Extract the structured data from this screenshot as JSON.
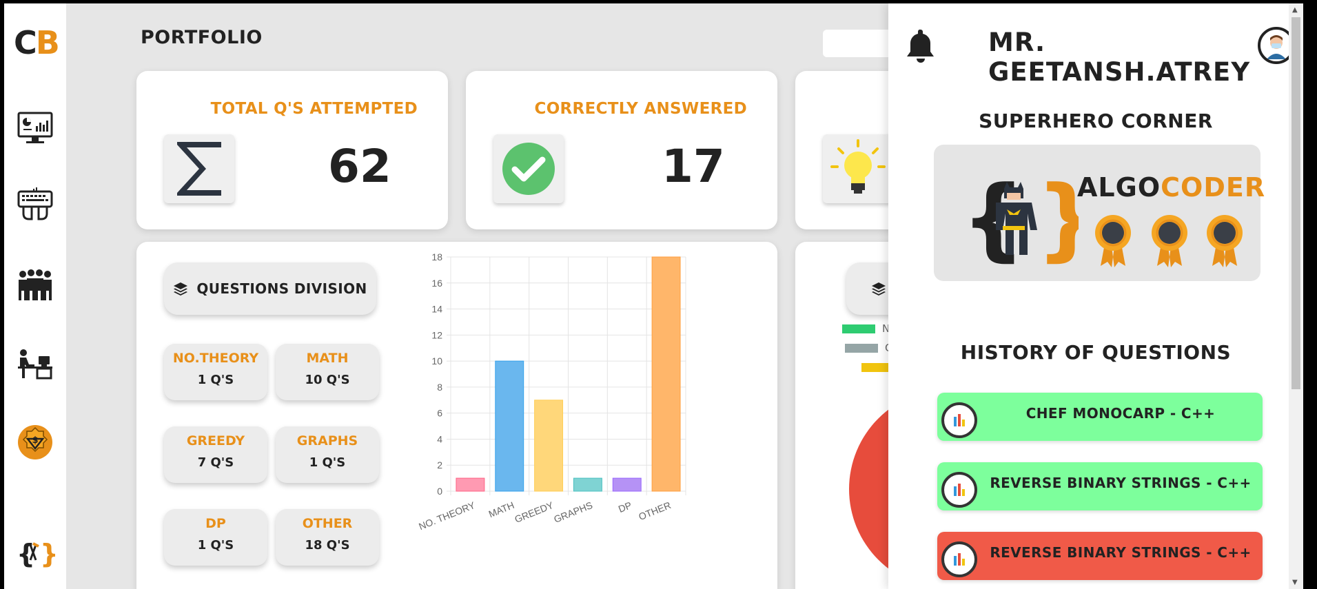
{
  "brand": {
    "logo_c": "C",
    "logo_b": "B"
  },
  "sidebar": {
    "items": [
      {
        "icon": "dashboard-icon"
      },
      {
        "icon": "keyboard-practice-icon"
      },
      {
        "icon": "community-icon"
      },
      {
        "icon": "workspace-icon"
      },
      {
        "icon": "premium-badge-icon"
      },
      {
        "icon": "code-tools-icon"
      }
    ]
  },
  "header": {
    "title": "PORTFOLIO"
  },
  "stats": {
    "attempted": {
      "label": "TOTAL Q'S ATTEMPTED",
      "value": "62",
      "icon": "sigma-icon"
    },
    "correct": {
      "label": "CORRECTLY ANSWERED",
      "value": "17",
      "icon": "check-circle-icon"
    },
    "third": {
      "icon": "lightbulb-icon"
    }
  },
  "division": {
    "button_label": "QUESTIONS DIVISION",
    "tiles": [
      {
        "title": "NO.THEORY",
        "count": "1 Q'S"
      },
      {
        "title": "MATH",
        "count": "10 Q'S"
      },
      {
        "title": "GREEDY",
        "count": "7 Q'S"
      },
      {
        "title": "GRAPHS",
        "count": "1 Q'S"
      },
      {
        "title": "DP",
        "count": "1 Q'S"
      },
      {
        "title": "OTHER",
        "count": "18 Q'S"
      }
    ]
  },
  "chart_data": {
    "type": "bar",
    "categories": [
      "NO. THEORY",
      "MATH",
      "GREEDY",
      "GRAPHS",
      "DP",
      "OTHER"
    ],
    "values": [
      1,
      10,
      7,
      1,
      1,
      18
    ],
    "colors": [
      "#ff9ab2",
      "#6ab7ee",
      "#ffd77a",
      "#7fd3d3",
      "#b592f5",
      "#ffb66a"
    ],
    "borders": [
      "#ff6384",
      "#36a2eb",
      "#ffce56",
      "#4bc0c0",
      "#9966ff",
      "#ff9f40"
    ],
    "ylim": [
      0,
      18
    ],
    "yticks": [
      "0",
      "2",
      "4",
      "6",
      "8",
      "10",
      "12",
      "14",
      "16",
      "18"
    ],
    "title": "",
    "xlabel": "",
    "ylabel": "",
    "grid": true
  },
  "legend_fragment": {
    "colors": [
      "#2ecc71",
      "#95a5a6",
      "#f1c40f"
    ],
    "labels": [
      "N",
      "C",
      ""
    ]
  },
  "user": {
    "name": "MR. GEETANSH.ATREY"
  },
  "superhero": {
    "section_title": "SUPERHERO CORNER",
    "name_part1": "ALGO",
    "name_part2": "CODER",
    "medal_count": 3
  },
  "history": {
    "section_title": "HISTORY OF QUESTIONS",
    "items": [
      {
        "label": "CHEF MONOCARP - C++",
        "status_color": "#7dff9c"
      },
      {
        "label": "REVERSE BINARY STRINGS - C++",
        "status_color": "#7dff9c"
      },
      {
        "label": "REVERSE BINARY STRINGS - C++",
        "status_color": "#f05a48"
      }
    ]
  }
}
